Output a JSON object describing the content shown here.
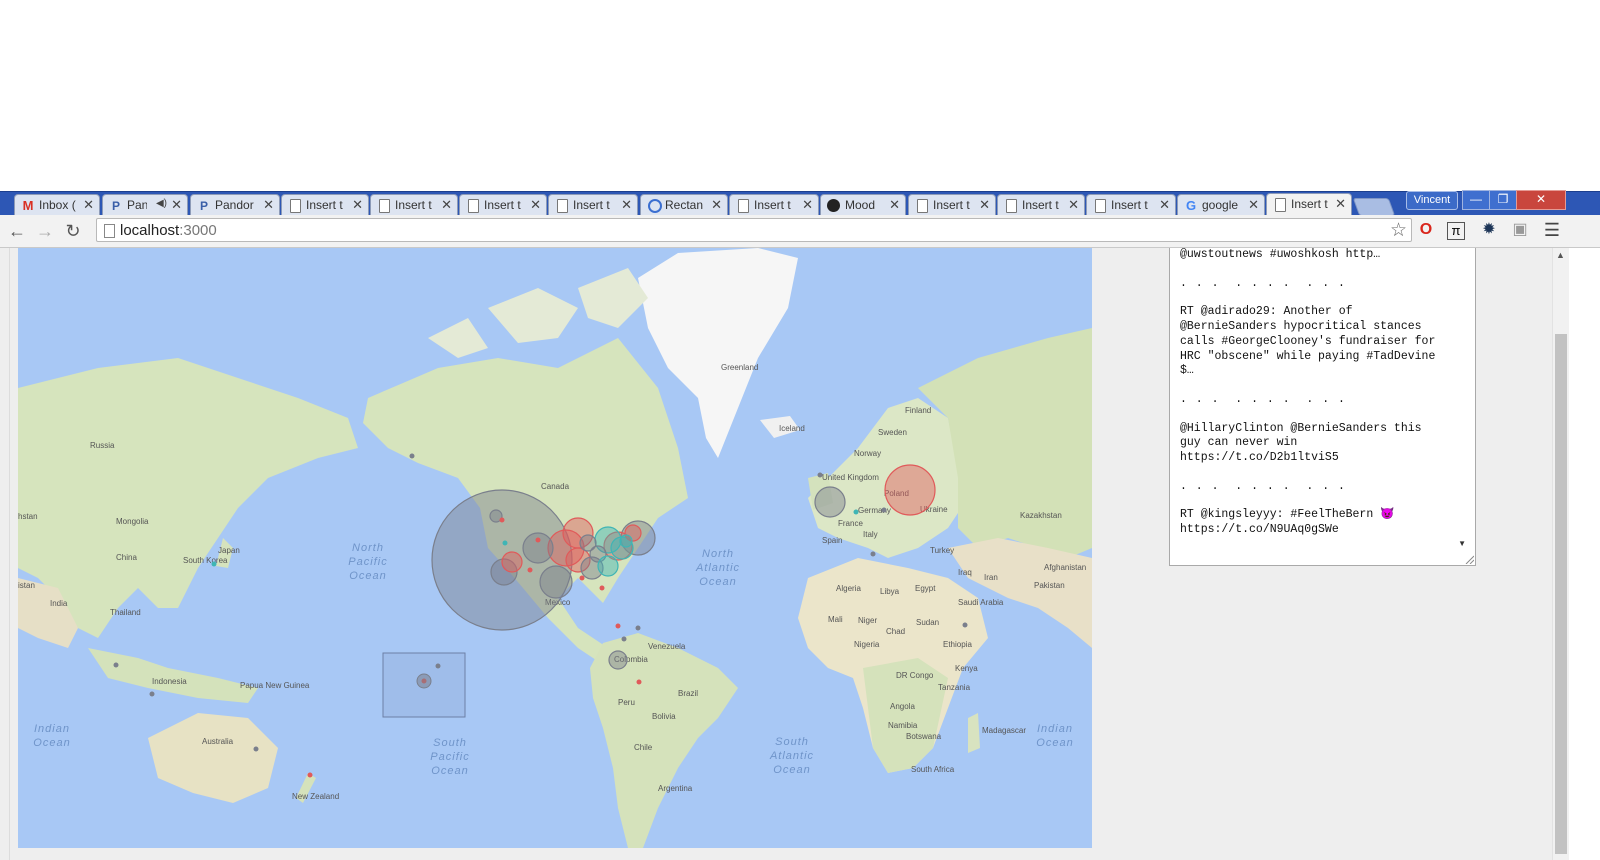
{
  "browser": {
    "tabs": [
      {
        "label": "Inbox (",
        "icon": "gmail-icon"
      },
      {
        "label": "Pan",
        "icon": "pandora-icon",
        "audio": true
      },
      {
        "label": "Pandor",
        "icon": "pandora-icon"
      },
      {
        "label": "Insert t",
        "icon": "document-icon"
      },
      {
        "label": "Insert t",
        "icon": "document-icon"
      },
      {
        "label": "Insert t",
        "icon": "document-icon"
      },
      {
        "label": "Insert t",
        "icon": "document-icon"
      },
      {
        "label": "Rectan",
        "icon": "loading-icon"
      },
      {
        "label": "Insert t",
        "icon": "document-icon"
      },
      {
        "label": "Mood",
        "icon": "github-icon"
      },
      {
        "label": "Insert t",
        "icon": "document-icon"
      },
      {
        "label": "Insert t",
        "icon": "document-icon"
      },
      {
        "label": "Insert t",
        "icon": "document-icon"
      },
      {
        "label": "google",
        "icon": "google-icon"
      },
      {
        "label": "Insert t",
        "icon": "document-icon",
        "active": true
      }
    ],
    "profile_name": "Vincent",
    "url_host": "localhost",
    "url_port": ":3000"
  },
  "map": {
    "land_labels": [
      "Greenland",
      "Iceland",
      "Finland",
      "Sweden",
      "Norway",
      "Russia",
      "Canada",
      "United Kingdom",
      "Poland",
      "Ukraine",
      "Germany",
      "France",
      "Spain",
      "Italy",
      "Turkey",
      "Kazakhstan",
      "Mongolia",
      "China",
      "Japan",
      "South Korea",
      "India",
      "Thailand",
      "Indonesia",
      "Papua New Guinea",
      "Australia",
      "New Zealand",
      "Mexico",
      "Venezuela",
      "Colombia",
      "Brazil",
      "Peru",
      "Bolivia",
      "Chile",
      "Argentina",
      "Algeria",
      "Libya",
      "Egypt",
      "Mali",
      "Niger",
      "Chad",
      "Sudan",
      "Ethiopia",
      "Nigeria",
      "DR Congo",
      "Kenya",
      "Tanzania",
      "Angola",
      "Namibia",
      "Botswana",
      "Madagascar",
      "South Africa",
      "Saudi Arabia",
      "Iraq",
      "Iran",
      "Afghanistan",
      "Pakistan",
      "istan",
      "hstan"
    ],
    "ocean_labels": {
      "north_pacific": [
        "North",
        "Pacific",
        "Ocean"
      ],
      "north_atlantic": [
        "North",
        "Atlantic",
        "Ocean"
      ],
      "south_pacific": [
        "South",
        "Pacific",
        "Ocean"
      ],
      "south_atlantic": [
        "South",
        "Atlantic",
        "Ocean"
      ],
      "indian_left": [
        "Indian",
        "Ocean"
      ],
      "indian_right": [
        "Indian",
        "Ocean"
      ]
    },
    "colors": {
      "water": "#a8c8f5",
      "land": "#e8ecd7",
      "green_land": "#c8dcb0",
      "ice": "#f6f6f6",
      "grey_marker": "#7a7f8c",
      "red_marker": "#e05a5a",
      "teal_marker": "#3fb5b5"
    }
  },
  "feed": {
    "tweets": [
      "@uwstoutnews #uwoshkosh http…",
      "RT @adirado29: Another of @BernieSanders hypocritical stances calls #GeorgeClooney's fundraiser for HRC \"obscene\" while paying #TadDevine $…",
      "@HillaryClinton @BernieSanders this guy can never win https://t.co/D2b1ltviS5",
      "RT @kingsleyyy: #FeelTheBern 😈 https://t.co/N9UAq0gSWe"
    ],
    "separator": ". . .  . . . .  . . ."
  }
}
